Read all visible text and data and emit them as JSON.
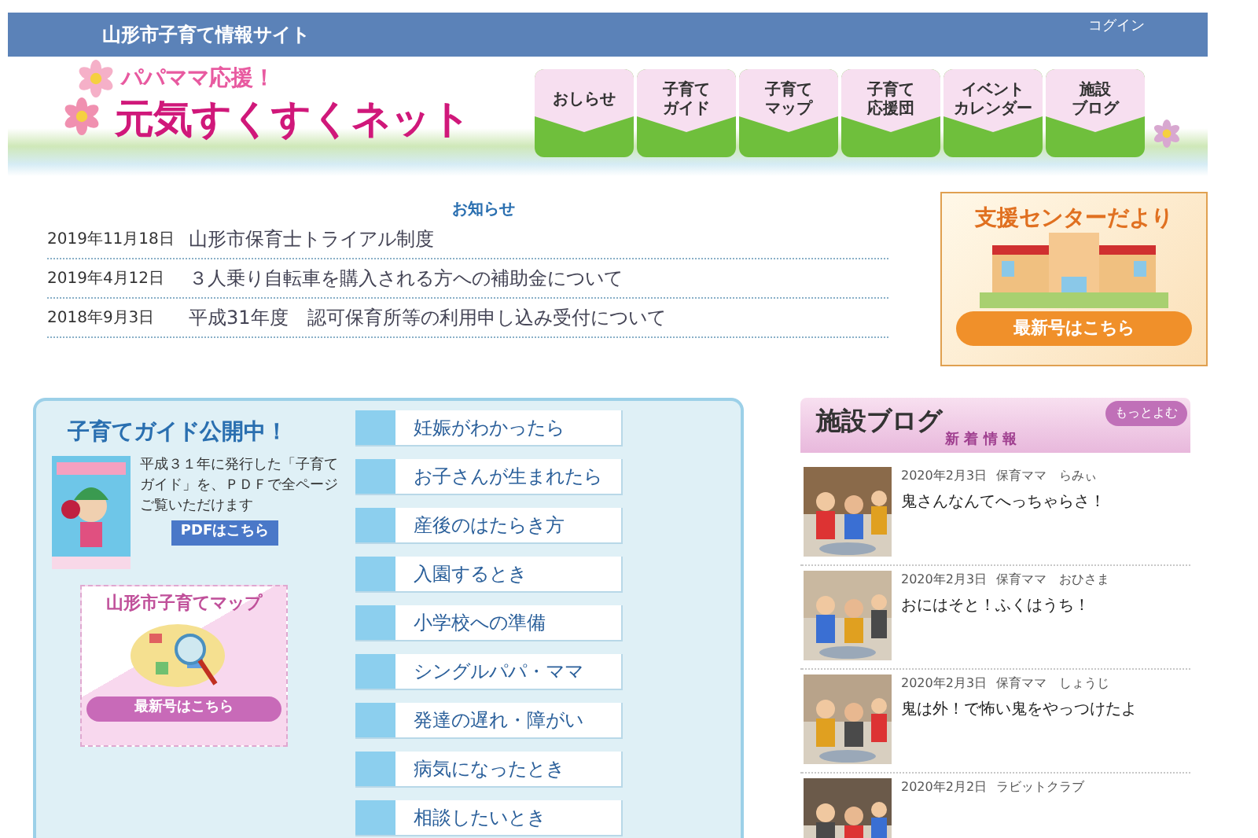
{
  "top_bar": {
    "site_title": "山形市子育て情報サイト",
    "login": "コグイン"
  },
  "logo": {
    "tagline": "パパママ応援！",
    "name": "元気すくすくネット"
  },
  "nav": [
    {
      "lines": [
        "おしらせ"
      ]
    },
    {
      "lines": [
        "子育て",
        "ガイド"
      ]
    },
    {
      "lines": [
        "子育て",
        "マップ"
      ]
    },
    {
      "lines": [
        "子育て",
        "応援団"
      ]
    },
    {
      "lines": [
        "イベント",
        "カレンダー"
      ]
    },
    {
      "lines": [
        "施設",
        "ブログ"
      ]
    }
  ],
  "news": {
    "title": "お知らせ",
    "items": [
      {
        "date": "2019年11月18日",
        "text": "山形市保育士トライアル制度"
      },
      {
        "date": "2019年4月12日",
        "text": "３人乗り自転車を購入される方への補助金について"
      },
      {
        "date": "2018年9月3日",
        "text": "平成31年度　認可保育所等の利用申し込み受付について"
      }
    ]
  },
  "support_banner": {
    "title": "支援センターだより",
    "button": "最新号はこちら"
  },
  "guide_panel": {
    "heading": "子育てガイド公開中！",
    "description": "平成３１年に発行した「子育てガイド」を、ＰＤＦで全ページご覧いただけます",
    "pdf_button": "PDFはこちら",
    "map_card": {
      "title": "山形市子育てマップ",
      "button": "最新号はこちら"
    },
    "links": [
      "妊娠がわかったら",
      "お子さんが生まれたら",
      "産後のはたらき方",
      "入園するとき",
      "小学校への準備",
      "シングルパパ・ママ",
      "発達の遅れ・障がい",
      "病気になったとき",
      "相談したいとき"
    ]
  },
  "blog": {
    "title": "施設ブログ",
    "subtitle": "新 着 情 報",
    "more": "もっとよむ",
    "posts": [
      {
        "date": "2020年2月3日",
        "author": "保育ママ　らみぃ",
        "title": "鬼さんなんてへっちゃらさ！"
      },
      {
        "date": "2020年2月3日",
        "author": "保育ママ　おひさま",
        "title": "おにはそと！ふくはうち！"
      },
      {
        "date": "2020年2月3日",
        "author": "保育ママ　しょうじ",
        "title": "鬼は外！で怖い鬼をやっつけたよ"
      },
      {
        "date": "2020年2月2日",
        "author": "ラビットクラブ"
      }
    ]
  }
}
